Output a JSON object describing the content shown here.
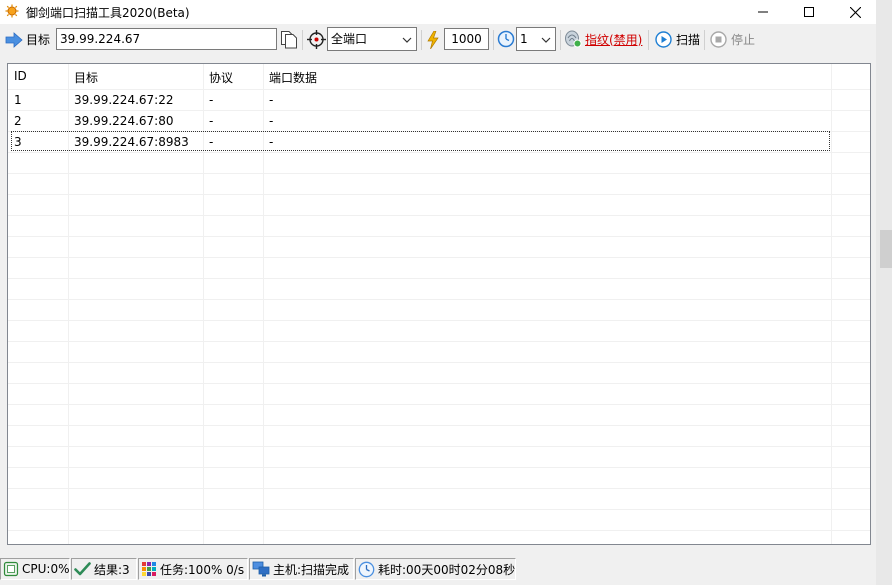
{
  "window": {
    "title": "御剑端口扫描工具2020(Beta)"
  },
  "toolbar": {
    "target_label": "目标",
    "target_value": "39.99.224.67",
    "scope_value": "全端口",
    "threads_value": "1000",
    "timeout_value": "1",
    "fingerprint_label": "指纹(禁用)",
    "scan_label": "扫描",
    "stop_label": "停止"
  },
  "table": {
    "columns": [
      "ID",
      "目标",
      "协议",
      "端口数据"
    ],
    "rows": [
      {
        "id": "1",
        "target": "39.99.224.67:22",
        "protocol": "-",
        "data": "-"
      },
      {
        "id": "2",
        "target": "39.99.224.67:80",
        "protocol": "-",
        "data": "-"
      },
      {
        "id": "3",
        "target": "39.99.224.67:8983",
        "protocol": "-",
        "data": "-"
      }
    ]
  },
  "status": {
    "cpu": "CPU:0%",
    "results": "结果:3",
    "tasks": "任务:100% 0/s",
    "host": "主机:扫描完成",
    "elapsed": "耗时:00天00时02分08秒"
  }
}
